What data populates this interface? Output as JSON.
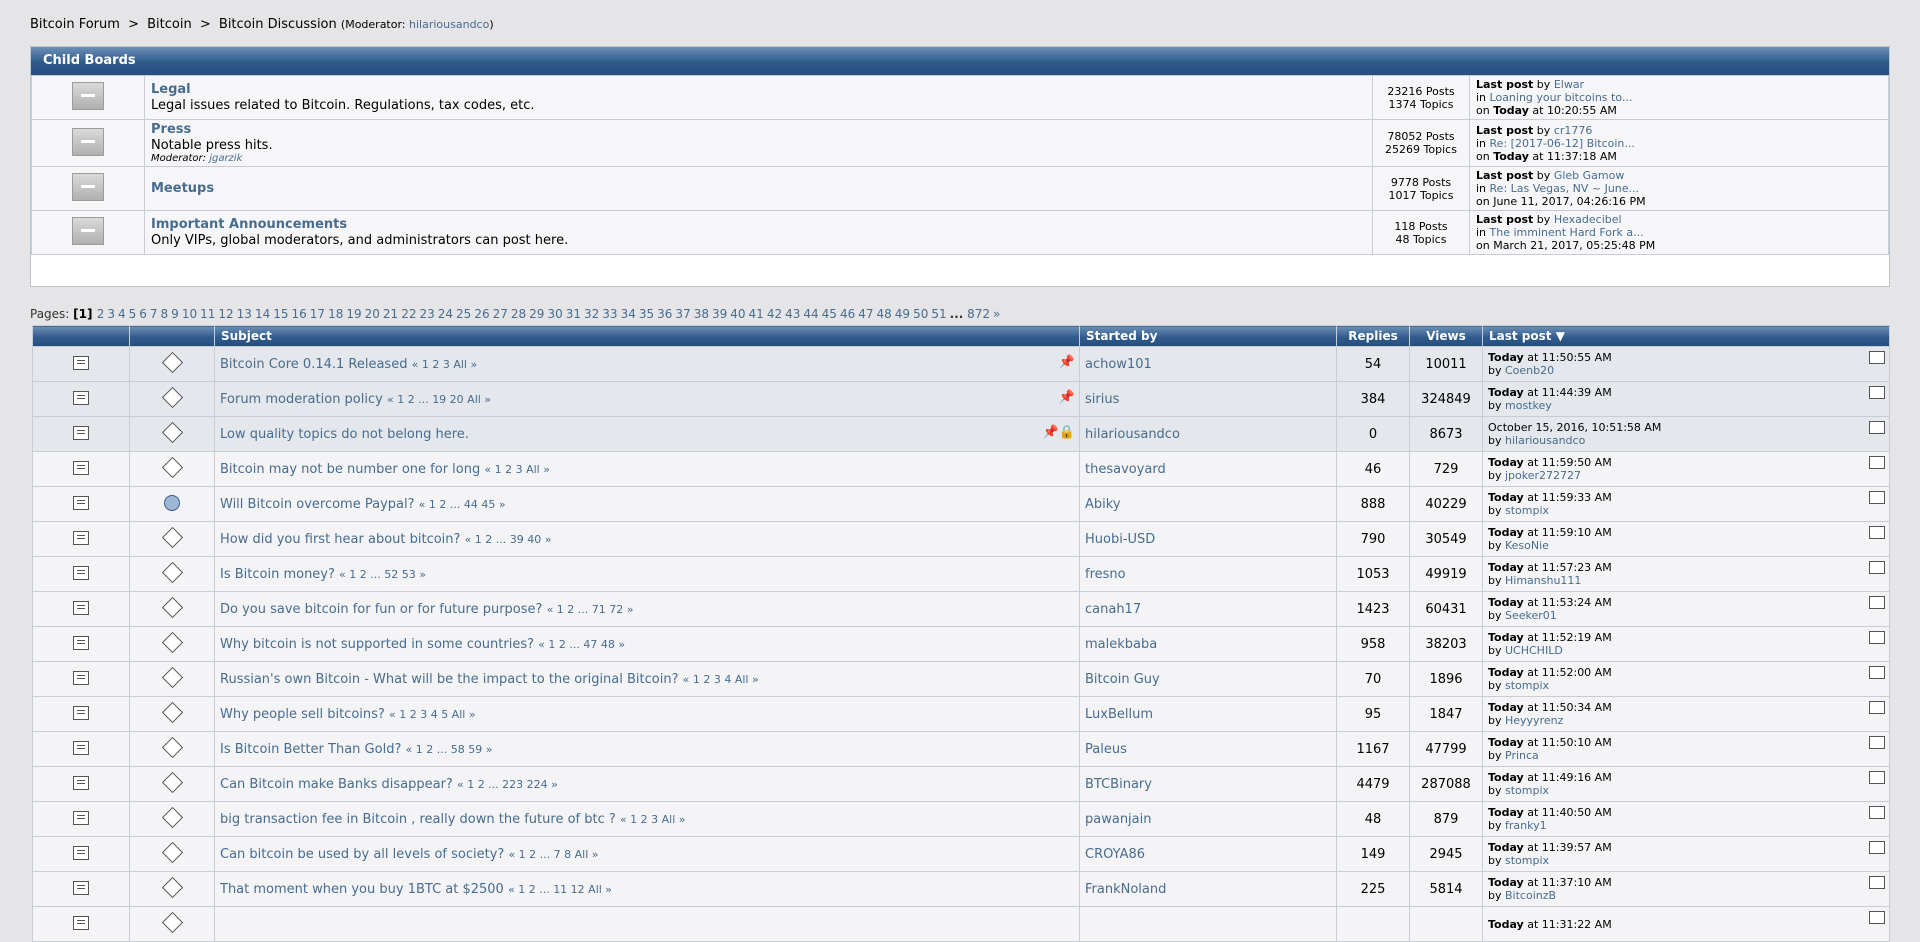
{
  "breadcrumb": {
    "items": [
      "Bitcoin Forum",
      "Bitcoin",
      "Bitcoin Discussion"
    ],
    "moderator_label": "(Moderator: ",
    "moderator": "hilariousandco",
    "moderator_close": ")"
  },
  "child_boards": {
    "title": "Child Boards",
    "boards": [
      {
        "name": "Legal",
        "desc": "Legal issues related to Bitcoin. Regulations, tax codes, etc.",
        "moderator": "",
        "posts": "23216 Posts",
        "topics": "1374 Topics",
        "last_by": "Elwar",
        "last_in": "Loaning your bitcoins to...",
        "last_on_bold": "Today",
        "last_on": " at 10:20:55 AM"
      },
      {
        "name": "Press",
        "desc": "Notable press hits.",
        "moderator": "jgarzik",
        "posts": "78052 Posts",
        "topics": "25269 Topics",
        "last_by": "cr1776",
        "last_in": "Re: [2017-06-12] Bitcoin...",
        "last_on_bold": "Today",
        "last_on": " at 11:37:18 AM"
      },
      {
        "name": "Meetups",
        "desc": "",
        "moderator": "",
        "posts": "9778 Posts",
        "topics": "1017 Topics",
        "last_by": "Gleb Gamow",
        "last_in": "Re: Las Vegas, NV ~ June...",
        "last_on_bold": "",
        "last_on": "on June 11, 2017, 04:26:16 PM"
      },
      {
        "name": "Important Announcements",
        "desc": "Only VIPs, global moderators, and administrators can post here.",
        "moderator": "",
        "posts": "118 Posts",
        "topics": "48 Topics",
        "last_by": "Hexadecibel",
        "last_in": "The imminent Hard Fork a...",
        "last_on_bold": "",
        "last_on": "on March 21, 2017, 05:25:48 PM"
      }
    ],
    "labels": {
      "last_post": "Last post",
      "by": " by ",
      "in": "in ",
      "on": "on ",
      "moderator": "Moderator: "
    }
  },
  "pagination": {
    "label": "Pages: ",
    "current": "1",
    "pages": [
      "2",
      "3",
      "4",
      "5",
      "6",
      "7",
      "8",
      "9",
      "10",
      "11",
      "12",
      "13",
      "14",
      "15",
      "16",
      "17",
      "18",
      "19",
      "20",
      "21",
      "22",
      "23",
      "24",
      "25",
      "26",
      "27",
      "28",
      "29",
      "30",
      "31",
      "32",
      "33",
      "34",
      "35",
      "36",
      "37",
      "38",
      "39",
      "40",
      "41",
      "42",
      "43",
      "44",
      "45",
      "46",
      "47",
      "48",
      "49",
      "50",
      "51"
    ],
    "ellipsis": "...",
    "last": "872",
    "next": "»"
  },
  "topic_table": {
    "headers": {
      "subject": "Subject",
      "started_by": "Started by",
      "replies": "Replies",
      "views": "Views",
      "last_post": "Last post"
    },
    "rows": [
      {
        "subject": "Bitcoin Core 0.14.1 Released",
        "pages": "« 1 2 3  All »",
        "starter": "achow101",
        "replies": "54",
        "views": "10011",
        "last_bold": "Today",
        "last_time": " at 11:50:55 AM",
        "last_by": "Coenb20",
        "sticky": true,
        "locked": false,
        "poll": false
      },
      {
        "subject": "Forum moderation policy",
        "pages": "« 1 2 ... 19 20  All »",
        "starter": "sirius",
        "replies": "384",
        "views": "324849",
        "last_bold": "Today",
        "last_time": " at 11:44:39 AM",
        "last_by": "mostkey",
        "sticky": true,
        "locked": false,
        "poll": false
      },
      {
        "subject": "Low quality topics do not belong here.",
        "pages": "",
        "starter": "hilariousandco",
        "replies": "0",
        "views": "8673",
        "last_bold": "",
        "last_time": "October 15, 2016, 10:51:58 AM",
        "last_by": "hilariousandco",
        "sticky": true,
        "locked": true,
        "poll": false
      },
      {
        "subject": "Bitcoin may not be number one for long",
        "pages": "« 1 2 3  All »",
        "starter": "thesavoyard",
        "replies": "46",
        "views": "729",
        "last_bold": "Today",
        "last_time": " at 11:59:50 AM",
        "last_by": "jpoker272727",
        "sticky": false,
        "locked": false,
        "poll": false
      },
      {
        "subject": "Will Bitcoin overcome Paypal?",
        "pages": "« 1 2 ... 44 45 »",
        "starter": "Abiky",
        "replies": "888",
        "views": "40229",
        "last_bold": "Today",
        "last_time": " at 11:59:33 AM",
        "last_by": "stompix",
        "sticky": false,
        "locked": false,
        "poll": true
      },
      {
        "subject": "How did you first hear about bitcoin?",
        "pages": "« 1 2 ... 39 40 »",
        "starter": "Huobi-USD",
        "replies": "790",
        "views": "30549",
        "last_bold": "Today",
        "last_time": " at 11:59:10 AM",
        "last_by": "KesoNie",
        "sticky": false,
        "locked": false,
        "poll": false
      },
      {
        "subject": "Is Bitcoin money?",
        "pages": "« 1 2 ... 52 53 »",
        "starter": "fresno",
        "replies": "1053",
        "views": "49919",
        "last_bold": "Today",
        "last_time": " at 11:57:23 AM",
        "last_by": "Himanshu111",
        "sticky": false,
        "locked": false,
        "poll": false
      },
      {
        "subject": "Do you save bitcoin for fun or for future purpose?",
        "pages": "« 1 2 ... 71 72 »",
        "starter": "canah17",
        "replies": "1423",
        "views": "60431",
        "last_bold": "Today",
        "last_time": " at 11:53:24 AM",
        "last_by": "Seeker01",
        "sticky": false,
        "locked": false,
        "poll": false
      },
      {
        "subject": "Why bitcoin is not supported in some countries?",
        "pages": "« 1 2 ... 47 48 »",
        "starter": "malekbaba",
        "replies": "958",
        "views": "38203",
        "last_bold": "Today",
        "last_time": " at 11:52:19 AM",
        "last_by": "UCHCHILD",
        "sticky": false,
        "locked": false,
        "poll": false
      },
      {
        "subject": "Russian's own Bitcoin - What will be the impact to the original Bitcoin?",
        "pages": "« 1 2 3 4  All »",
        "starter": "Bitcoin Guy",
        "replies": "70",
        "views": "1896",
        "last_bold": "Today",
        "last_time": " at 11:52:00 AM",
        "last_by": "stompix",
        "sticky": false,
        "locked": false,
        "poll": false
      },
      {
        "subject": "Why people sell bitcoins?",
        "pages": "« 1 2 3 4 5  All »",
        "starter": "LuxBellum",
        "replies": "95",
        "views": "1847",
        "last_bold": "Today",
        "last_time": " at 11:50:34 AM",
        "last_by": "Heyyyrenz",
        "sticky": false,
        "locked": false,
        "poll": false
      },
      {
        "subject": "Is Bitcoin Better Than Gold?",
        "pages": "« 1 2 ... 58 59 »",
        "starter": "Paleus",
        "replies": "1167",
        "views": "47799",
        "last_bold": "Today",
        "last_time": " at 11:50:10 AM",
        "last_by": "Princa",
        "sticky": false,
        "locked": false,
        "poll": false
      },
      {
        "subject": "Can Bitcoin make Banks disappear?",
        "pages": "« 1 2 ... 223 224 »",
        "starter": "BTCBinary",
        "replies": "4479",
        "views": "287088",
        "last_bold": "Today",
        "last_time": " at 11:49:16 AM",
        "last_by": "stompix",
        "sticky": false,
        "locked": false,
        "poll": false
      },
      {
        "subject": "big transaction fee in Bitcoin , really down the future of btc ?",
        "pages": "« 1 2 3  All »",
        "starter": "pawanjain",
        "replies": "48",
        "views": "879",
        "last_bold": "Today",
        "last_time": " at 11:40:50 AM",
        "last_by": "franky1",
        "sticky": false,
        "locked": false,
        "poll": false
      },
      {
        "subject": "Can bitcoin be used by all levels of society?",
        "pages": "« 1 2 ... 7 8  All »",
        "starter": "CROYA86",
        "replies": "149",
        "views": "2945",
        "last_bold": "Today",
        "last_time": " at 11:39:57 AM",
        "last_by": "stompix",
        "sticky": false,
        "locked": false,
        "poll": false
      },
      {
        "subject": "That moment when you buy 1BTC at $2500",
        "pages": "« 1 2 ... 11 12  All »",
        "starter": "FrankNoland",
        "replies": "225",
        "views": "5814",
        "last_bold": "Today",
        "last_time": " at 11:37:10 AM",
        "last_by": "BitcoinzB",
        "sticky": false,
        "locked": false,
        "poll": false
      },
      {
        "subject": "",
        "pages": "",
        "starter": "",
        "replies": "",
        "views": "",
        "last_bold": "Today",
        "last_time": " at 11:31:22 AM",
        "last_by": "",
        "sticky": false,
        "locked": false,
        "poll": false
      }
    ],
    "by_label": "by "
  }
}
